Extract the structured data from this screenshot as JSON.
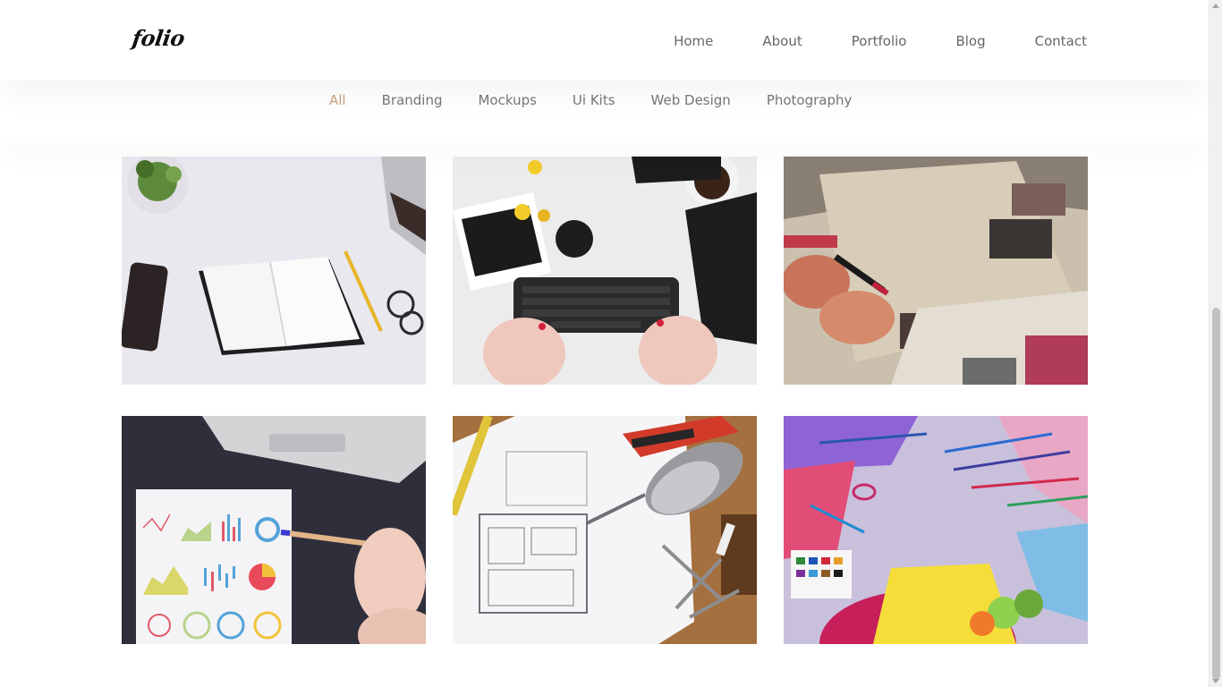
{
  "header": {
    "logo": "folio",
    "nav": [
      "Home",
      "About",
      "Portfolio",
      "Blog",
      "Contact"
    ]
  },
  "filters": {
    "items": [
      "All",
      "Branding",
      "Mockups",
      "Ui Kits",
      "Web Design",
      "Photography"
    ],
    "active": "All"
  },
  "gallery": {
    "items": [
      {
        "subject": "notebook-desk-photo"
      },
      {
        "subject": "keyboard-creative-mess-photo"
      },
      {
        "subject": "hand-lettering-collage-photo"
      },
      {
        "subject": "charts-report-pencil-photo"
      },
      {
        "subject": "blueprint-drill-photo"
      },
      {
        "subject": "art-supplies-photo"
      }
    ]
  },
  "colors": {
    "accent": "#c8a27a",
    "nav_text": "#666666",
    "filter_text": "#777777"
  }
}
